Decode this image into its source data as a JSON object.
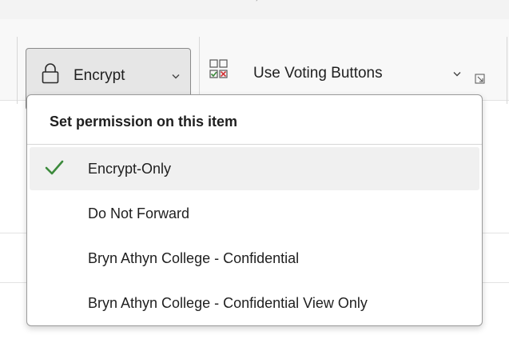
{
  "ribbon": {
    "encrypt_button": {
      "label": "Encrypt",
      "icon": "lock-icon",
      "dropdown_icon": "chevron-down-icon"
    },
    "voting_button": {
      "label": "Use Voting Buttons",
      "icon": "voting-buttons-icon",
      "dropdown_icon": "chevron-down-icon"
    },
    "group_launcher_icon": "dialog-launcher-icon"
  },
  "permission_menu": {
    "header": "Set permission on this item",
    "items": [
      {
        "label": "Encrypt-Only",
        "checked": true
      },
      {
        "label": "Do Not Forward",
        "checked": false
      },
      {
        "label": "Bryn Athyn College - Confidential",
        "checked": false
      },
      {
        "label": "Bryn Athyn College - Confidential View Only",
        "checked": false
      }
    ]
  },
  "colors": {
    "check": "#3c8a3c",
    "selected_item_bg": "#f0f0f0",
    "button_pressed_bg": "#e6e6e6",
    "vote_check": "#3c8a3c",
    "vote_cross": "#d13438"
  }
}
